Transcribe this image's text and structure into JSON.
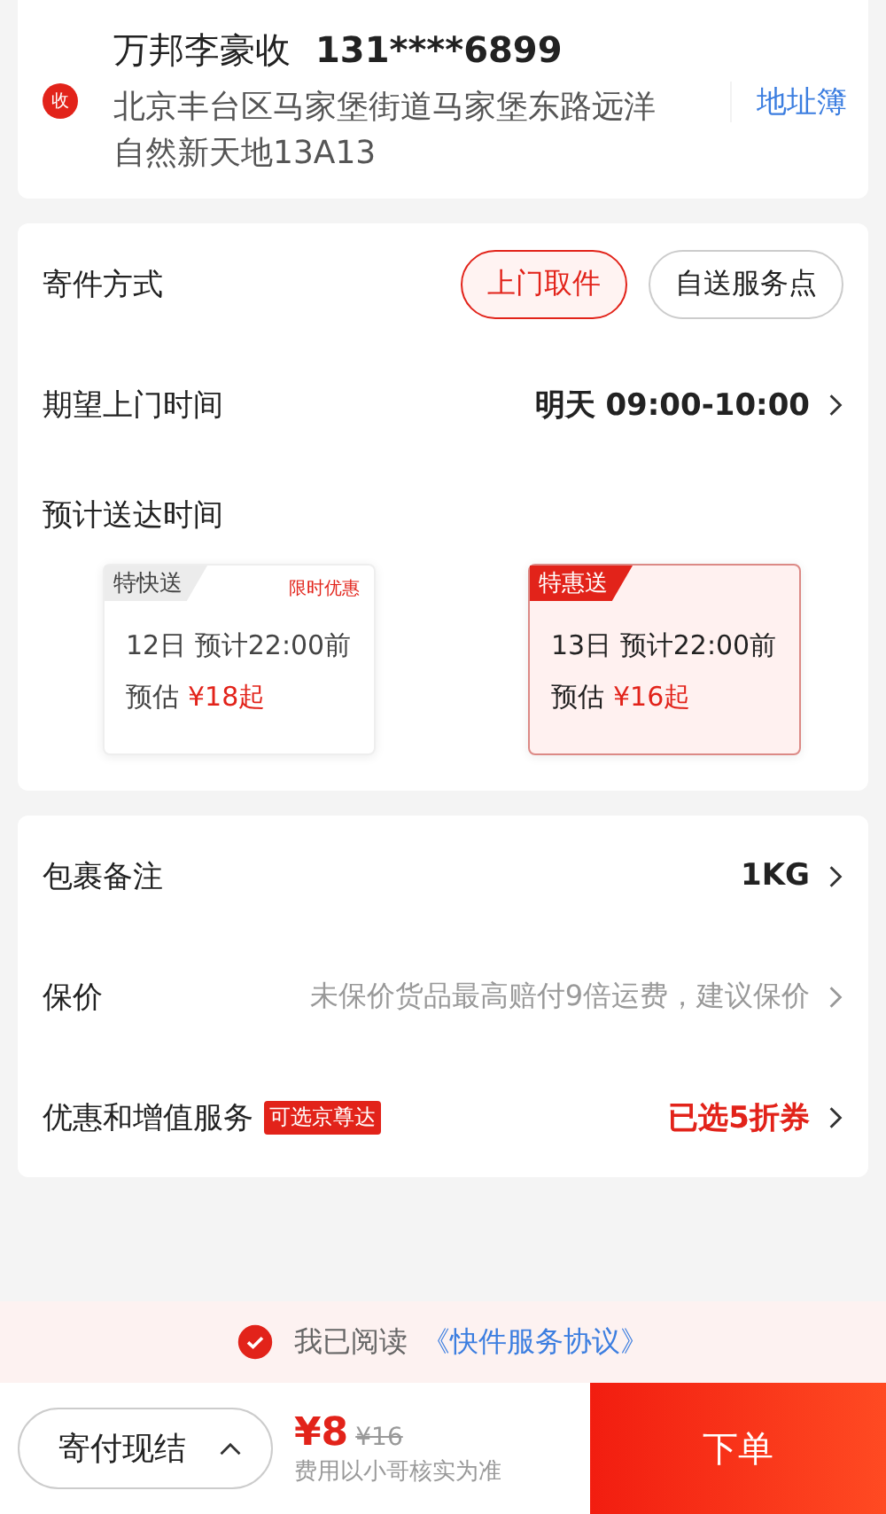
{
  "receiver": {
    "badge": "收",
    "name": "万邦李豪收",
    "phone": "131****6899",
    "address": "北京丰台区马家堡街道马家堡东路远洋自然新天地13A13",
    "address_book": "地址簿"
  },
  "send_method": {
    "label": "寄件方式",
    "options": [
      {
        "label": "上门取件",
        "selected": true
      },
      {
        "label": "自送服务点",
        "selected": false
      }
    ]
  },
  "pickup_time": {
    "label": "期望上门时间",
    "value": "明天 09:00-10:00"
  },
  "delivery": {
    "label": "预计送达时间",
    "options": [
      {
        "tag": "特快送",
        "promo": "限时优惠",
        "arrival": "12日 预计22:00前",
        "estimate_label": "预估",
        "price": "¥18起",
        "selected": false
      },
      {
        "tag": "特惠送",
        "arrival": "13日 预计22:00前",
        "estimate_label": "预估",
        "price": "¥16起",
        "selected": true
      }
    ]
  },
  "rows": [
    {
      "kind": "value",
      "label": "包裹备注",
      "value": "1KG"
    },
    {
      "kind": "hint",
      "label": "保价",
      "value": "未保价货品最高赔付9倍运费，建议保价"
    },
    {
      "kind": "highlight",
      "label": "优惠和增值服务",
      "badge": "可选京尊达",
      "value": "已选5折券"
    }
  ],
  "agreement": {
    "checked": true,
    "text": "我已阅读",
    "link": "《快件服务协议》"
  },
  "footer": {
    "payment": "寄付现结",
    "price": "¥8",
    "original_price": "¥16",
    "note": "费用以小哥核实为准",
    "submit": "下单"
  }
}
